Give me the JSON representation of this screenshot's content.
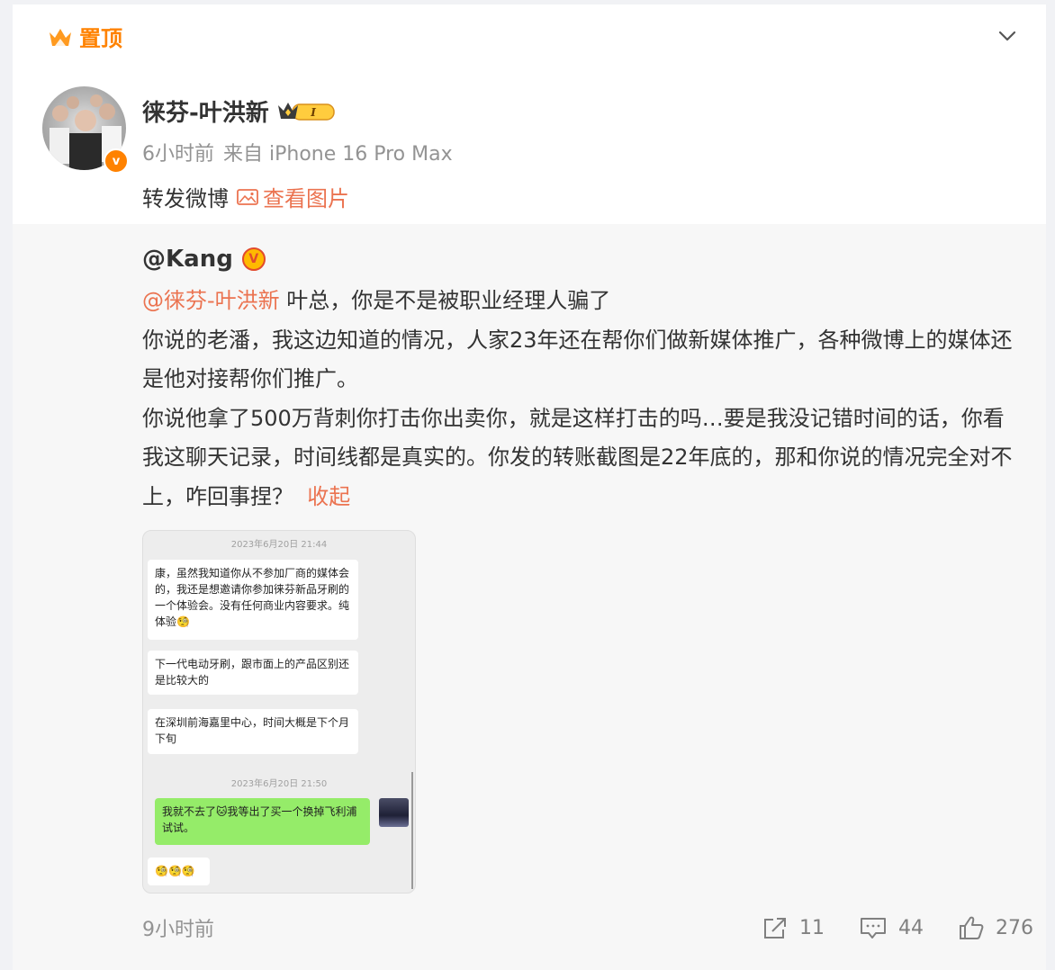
{
  "pin": {
    "label": "置顶"
  },
  "post": {
    "author": "徕芬-叶洪新",
    "level_badge": "I",
    "time": "6小时前",
    "source": "来自 iPhone 16 Pro Max",
    "text": "转发微博",
    "view_pic_label": "查看图片"
  },
  "retweet": {
    "author": "@Kang",
    "mention": "@徕芬-叶洪新",
    "line1_rest": " 叶总，你是不是被职业经理人骗了",
    "para2": "你说的老潘，我这边知道的情况，人家23年还在帮你们做新媒体推广，各种微博上的媒体还是他对接帮你们推广。",
    "para3": "你说他拿了500万背刺你打击你出卖你，就是这样打击的吗…要是我没记错时间的话，你看我这聊天记录，时间线都是真实的。你发的转账截图是22年底的，那和你说的情况完全对不上，咋回事捏？",
    "collapse_label": "收起",
    "chat": {
      "ts1": "2023年6月20日 21:44",
      "msg1": "康，虽然我知道你从不参加厂商的媒体会的，我还是想邀请你参加徕芬新品牙刷的一个体验会。没有任何商业内容要求。纯体验🧐",
      "msg2": "下一代电动牙刷，跟市面上的产品区别还是比较大的",
      "msg3": "在深圳前海嘉里中心，时间大概是下个月下旬",
      "ts2": "2023年6月20日 21:50",
      "msg4": "我就不去了🐱我等出了买一个换掉飞利浦试试。",
      "msg5": "🧐🧐🧐"
    },
    "time": "9小时前",
    "reposts": "11",
    "comments": "44",
    "likes": "276"
  },
  "colors": {
    "accent": "#ff8200",
    "link": "#eb7350",
    "meta": "#939393",
    "quote_bg": "#f7f7f7"
  }
}
